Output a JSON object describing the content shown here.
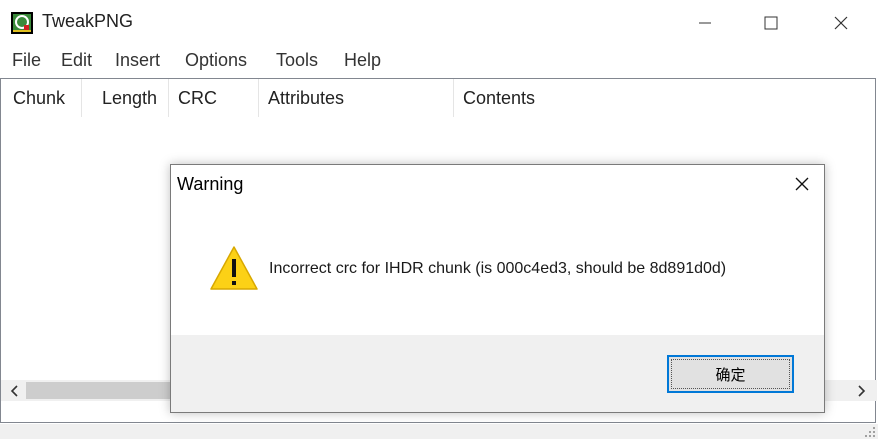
{
  "window": {
    "title": "TweakPNG"
  },
  "menu": [
    "File",
    "Edit",
    "Insert",
    "Options",
    "Tools",
    "Help"
  ],
  "columns": [
    "Chunk",
    "Length",
    "CRC",
    "Attributes",
    "Contents"
  ],
  "dialog": {
    "title": "Warning",
    "message": "Incorrect crc for IHDR chunk (is 000c4ed3, should be 8d891d0d)",
    "ok_label": "确定"
  },
  "colors": {
    "accent": "#0078d7",
    "warning": "#fcd116"
  }
}
